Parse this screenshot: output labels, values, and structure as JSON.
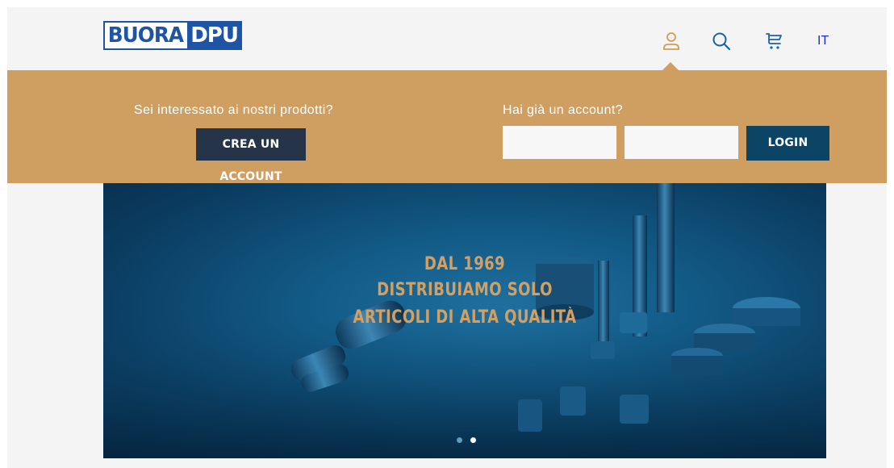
{
  "header": {
    "logo_text_a": "BUORA",
    "logo_text_b": "DPU",
    "icons": [
      "user-icon",
      "search-icon",
      "cart-icon"
    ],
    "language": "IT"
  },
  "account_panel": {
    "signup_question": "Sei interessato ai nostri prodotti?",
    "create_account_label": "CREA UN ACCOUNT",
    "login_question": "Hai già un account?",
    "username_value": "",
    "password_value": "",
    "login_label": "LOGIN"
  },
  "hero": {
    "line1": "DAL 1969",
    "line2": "DISTRIBUIAMO SOLO",
    "line3": "ARTICOLI DI ALTA QUALITÀ",
    "slides": 2,
    "active_slide": 2
  },
  "colors": {
    "page_bg": "#f4f4f4",
    "panel": "#cf9f62",
    "brand_blue": "#1e54a3",
    "create_button": "#263449",
    "login_button": "#0c4466",
    "hero_text": "#d3a064",
    "user_icon": "#d39c54",
    "nav_icon": "#1b61a8"
  }
}
